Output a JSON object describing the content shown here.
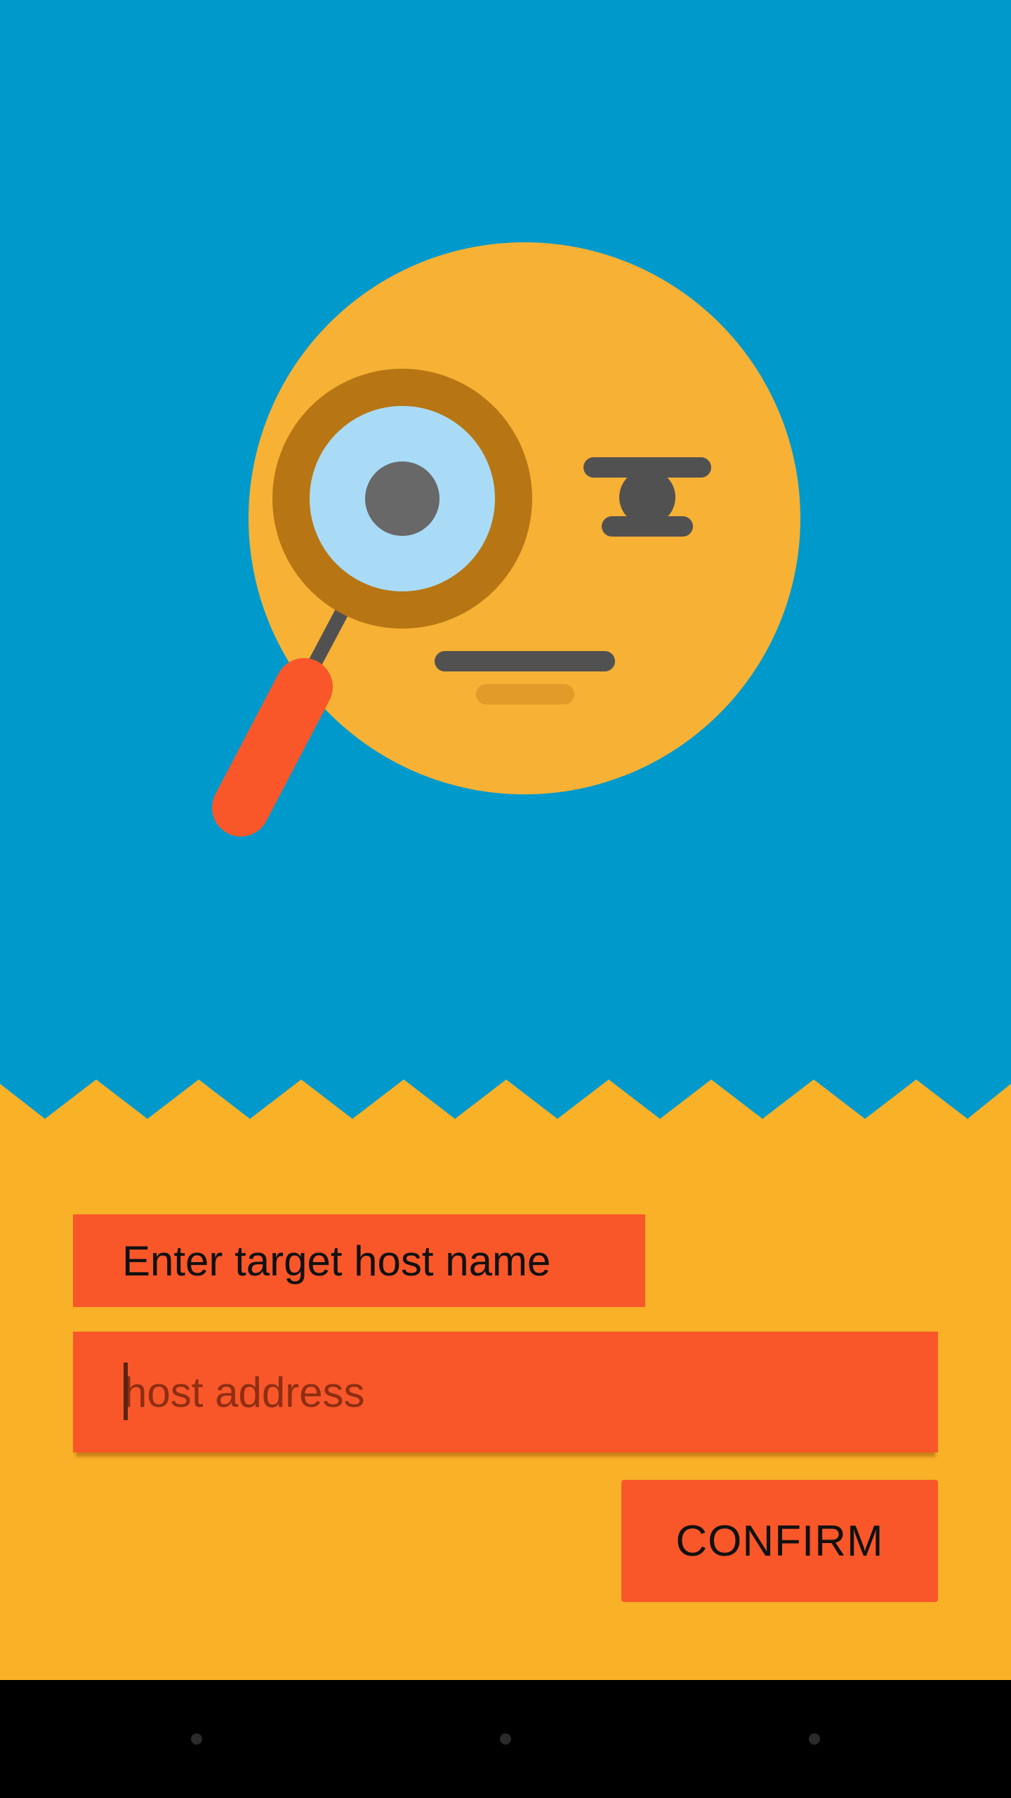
{
  "colors": {
    "sky": "#0099CC",
    "ground": "#F9B128",
    "accent": "#F9572A",
    "face": "#F7B135",
    "lens_rim": "#B77613",
    "lens": "#A9DBF6",
    "feature_gray": "#515151",
    "nav_bar": "#000000"
  },
  "illustration": {
    "icon": "detective-face-with-magnifying-glass-icon"
  },
  "form": {
    "label": "Enter target host name",
    "input_value": "",
    "input_placeholder": "host address",
    "confirm_label": "CONFIRM"
  },
  "nav_bar": {
    "icons": [
      "back-dot-icon",
      "home-dot-icon",
      "recents-dot-icon"
    ]
  }
}
